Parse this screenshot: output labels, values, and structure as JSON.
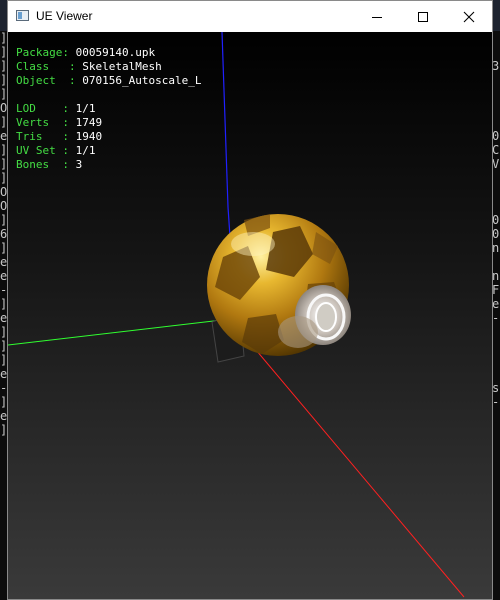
{
  "background_console": {
    "left_chars": [
      "]",
      "]",
      "]",
      "]",
      "]",
      "O",
      "]",
      "e",
      "]",
      "]",
      "]",
      "O",
      "O",
      "]",
      "6",
      "]",
      "e",
      "e",
      "-",
      "]",
      "e",
      "]",
      "]",
      "]",
      "e",
      "-",
      "]",
      "e",
      "]"
    ],
    "right_chars": [
      "",
      "",
      "3",
      "",
      "",
      "",
      "",
      "0",
      "C",
      "V",
      "",
      "",
      "",
      "0",
      "0",
      "n",
      "",
      "n",
      "F",
      "e",
      "-",
      "",
      "",
      "",
      "",
      "s",
      "-",
      "",
      "",
      "",
      ""
    ]
  },
  "window": {
    "title": "UE Viewer",
    "controls": {
      "minimize": "minimize",
      "maximize": "maximize",
      "close": "close"
    }
  },
  "info": {
    "package": {
      "label": "Package: ",
      "value": "00059140.upk"
    },
    "class": {
      "label": "Class   : ",
      "value": "SkeletalMesh"
    },
    "object": {
      "label": "Object  : ",
      "value": "070156_Autoscale_L"
    },
    "lod": {
      "label": "LOD    : ",
      "value": "1/1"
    },
    "verts": {
      "label": "Verts  : ",
      "value": "1749"
    },
    "tris": {
      "label": "Tris   : ",
      "value": "1940"
    },
    "uvset": {
      "label": "UV Set : ",
      "value": "1/1"
    },
    "bones": {
      "label": "Bones  : ",
      "value": "3"
    }
  },
  "colors": {
    "axis_x": "#ff2020",
    "axis_y": "#30ff30",
    "axis_z": "#2020ff",
    "label_green": "#44dd44",
    "ball_gold": "#c8a020"
  }
}
